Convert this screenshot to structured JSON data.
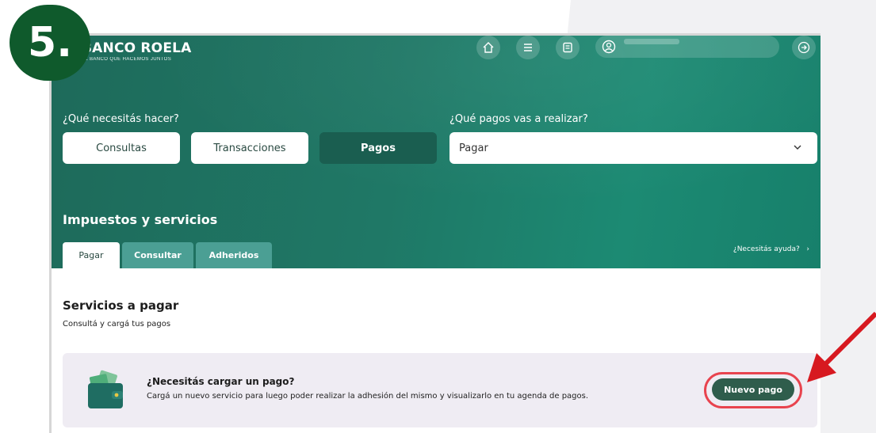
{
  "step": {
    "label": "5."
  },
  "header": {
    "brand_name": "BANCO ROELA",
    "brand_tagline": "EL BANCO QUE HACEMOS JUNTOS",
    "icons": [
      "home-icon",
      "menu-icon",
      "document-icon",
      "user-icon",
      "logout-icon"
    ]
  },
  "action_picker": {
    "label": "¿Qué necesitás hacer?",
    "buttons": [
      "Consultas",
      "Transacciones",
      "Pagos"
    ],
    "active": "Pagos"
  },
  "payment_picker": {
    "label": "¿Qué pagos vas a realizar?",
    "value": "Pagar"
  },
  "section": {
    "title": "Impuestos y servicios",
    "tabs": [
      "Pagar",
      "Consultar",
      "Adheridos"
    ],
    "active_tab": "Pagar",
    "help_link": "¿Necesitás ayuda?"
  },
  "content": {
    "title": "Servicios a pagar",
    "subtitle": "Consultá y cargá tus pagos"
  },
  "card": {
    "title": "¿Necesitás cargar un pago?",
    "description": "Cargá un nuevo servicio para luego poder realizar la adhesión del mismo y visualizarlo en tu agenda de pagos.",
    "button": "Nuevo pago"
  },
  "colors": {
    "hero_green": "#1f7866",
    "active_button": "#1a5e50",
    "tab_inactive": "#4b9f94",
    "cta_button": "#2f5d4c",
    "highlight_red": "#e8434e",
    "step_badge": "#0f5a2c",
    "arrow": "#d71920"
  }
}
